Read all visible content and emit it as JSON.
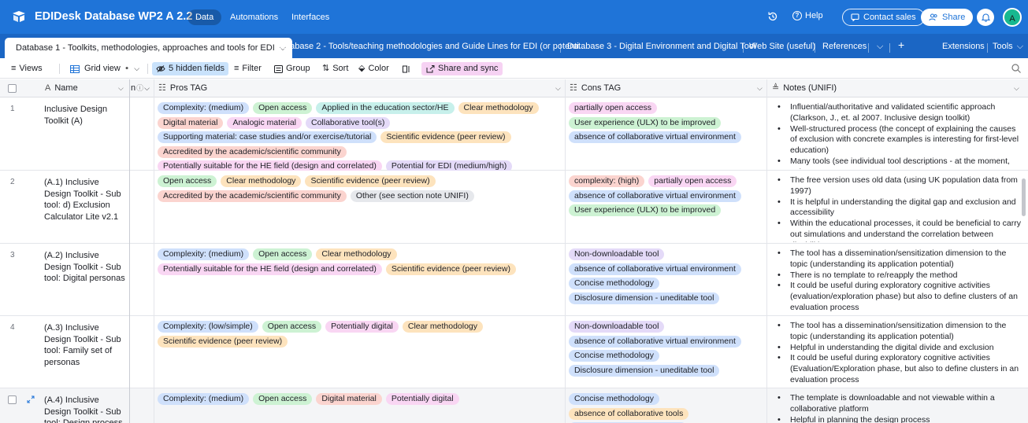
{
  "app": {
    "base_title": "EDIDesk Database WP2 A 2.2",
    "nav": [
      "Data",
      "Automations",
      "Interfaces"
    ],
    "help": "Help",
    "contact_sales": "Contact sales",
    "share": "Share",
    "avatar": "A",
    "accent": "#1f74d8"
  },
  "tables": {
    "active": "Database 1 - Toolkits, methodologies, approaches and tools for EDI",
    "others": [
      "Database 2 - Tools/teaching methodologies and Guide Lines for EDI (or potenti...",
      "Database 3 - Digital Environment and Digital Tool",
      "Web Site (useful)",
      "References"
    ],
    "add": "+",
    "extensions": "Extensions",
    "tools": "Tools"
  },
  "viewbar": {
    "views": "Views",
    "grid_view": "Grid view",
    "hidden_fields": "5 hidden fields",
    "filter": "Filter",
    "group": "Group",
    "sort": "Sort",
    "color": "Color",
    "share_sync": "Share and sync"
  },
  "columns": {
    "name": "Name",
    "hidden_fragment": "n",
    "pros": "Pros TAG",
    "cons": "Cons TAG",
    "notes": "Notes (UNIFI)"
  },
  "rows": [
    {
      "num": "1",
      "name": "Inclusive Design Toolkit (A)",
      "pros": [
        {
          "t": "Complexity: (medium)",
          "c": "blue"
        },
        {
          "t": "Open access",
          "c": "green"
        },
        {
          "t": "Applied in the education sector/HE",
          "c": "teal"
        },
        {
          "t": "Clear methodology",
          "c": "orange"
        },
        {
          "t": "Digital material",
          "c": "red"
        },
        {
          "t": "Analogic material",
          "c": "pink"
        },
        {
          "t": "Collaborative tool(s)",
          "c": "purple"
        },
        {
          "t": "Supporting material: case studies and/or exercise/tutorial",
          "c": "blue"
        },
        {
          "t": "Scientific evidence (peer review)",
          "c": "orange"
        },
        {
          "t": "Accredited by the academic/scientific community",
          "c": "red"
        },
        {
          "t": "Potentially suitable for the HE field (design and correlated)",
          "c": "pink"
        },
        {
          "t": "Potential for EDI (medium/high)",
          "c": "purple"
        }
      ],
      "cons": [
        {
          "t": "partially open access",
          "c": "pink"
        },
        {
          "t": "User experience (ULX) to be improved",
          "c": "green"
        },
        {
          "t": "absence of collaborative virtual environment",
          "c": "blue"
        }
      ],
      "notes": [
        "Influential/authoritative and validated scientific approach (Clarkson, J., et. al 2007. Inclusive design toolkit)",
        "Well-structured process (the concept of explaining the causes of exclusion with concrete examples is interesting for first-level education)",
        "Many tools (see individual tool descriptions - at the moment, only..."
      ]
    },
    {
      "num": "2",
      "name": "(A.1) Inclusive Design Toolkit  - Sub tool: d) Exclusion Calculator Lite v2.1",
      "pros": [
        {
          "t": "Open access",
          "c": "green"
        },
        {
          "t": "Clear methodology",
          "c": "orange"
        },
        {
          "t": "Scientific evidence (peer review)",
          "c": "orange"
        },
        {
          "t": "Accredited by the academic/scientific community",
          "c": "red"
        },
        {
          "t": "Other (see section note UNIFI)",
          "c": "gray"
        }
      ],
      "cons": [
        {
          "t": "complexity: (high)",
          "c": "red"
        },
        {
          "t": "partially open access",
          "c": "pink"
        },
        {
          "t": "absence of collaborative virtual environment",
          "c": "blue"
        },
        {
          "t": "User experience (ULX) to be improved",
          "c": "green"
        }
      ],
      "notes": [
        "The free version uses old data (using UK population data from 1997)",
        "It is helpful in understanding the digital gap and exclusion and accessibility",
        "Within the educational processes, it could be beneficial to carry out simulations and understand the correlation between disabiliti..."
      ]
    },
    {
      "num": "3",
      "name": "(A.2) Inclusive Design Toolkit  - Sub tool: Digital personas",
      "pros": [
        {
          "t": "Complexity: (medium)",
          "c": "blue"
        },
        {
          "t": "Open access",
          "c": "green"
        },
        {
          "t": "Clear methodology",
          "c": "orange"
        },
        {
          "t": "Potentially suitable for the HE field (design and correlated)",
          "c": "pink"
        },
        {
          "t": "Scientific evidence (peer review)",
          "c": "orange"
        }
      ],
      "cons": [
        {
          "t": "Non-downloadable tool",
          "c": "purple"
        },
        {
          "t": "absence of collaborative virtual environment",
          "c": "blue"
        },
        {
          "t": "Concise methodology",
          "c": "blue"
        },
        {
          "t": "Disclosure dimension - uneditable tool",
          "c": "blue"
        }
      ],
      "notes": [
        "The tool has a dissemination/sensitization dimension to the topic (understanding its application potential)",
        "There is no template to re/reapply the method",
        "It could be useful during exploratory cognitive activities (evaluation/exploration phase) but also to define clusters of an evaluation process"
      ]
    },
    {
      "num": "4",
      "name": "(A.3) Inclusive Design Toolkit  - Sub tool: Family set of personas",
      "pros": [
        {
          "t": "Complexity: (low/simple)",
          "c": "blue"
        },
        {
          "t": "Open access",
          "c": "green"
        },
        {
          "t": "Potentially digital",
          "c": "pink"
        },
        {
          "t": "Clear methodology",
          "c": "orange"
        },
        {
          "t": "Scientific evidence (peer review)",
          "c": "orange"
        }
      ],
      "cons": [
        {
          "t": "Non-downloadable tool",
          "c": "purple"
        },
        {
          "t": "absence of collaborative virtual environment",
          "c": "blue"
        },
        {
          "t": "Concise methodology",
          "c": "blue"
        },
        {
          "t": "Disclosure dimension - uneditable tool",
          "c": "blue"
        }
      ],
      "notes": [
        "The tool has a dissemination/sensitization dimension to the topic (understanding its application potential)",
        "Helpful in understanding the digital divide and exclusion",
        "It could be useful during exploratory cognitive activities (Evaluation/Exploration phase, but also to define clusters in an evaluation process"
      ]
    },
    {
      "num": "",
      "name": "(A.4) Inclusive Design Toolkit  - Sub tool: Design process",
      "pros": [
        {
          "t": "Complexity: (medium)",
          "c": "blue"
        },
        {
          "t": "Open access",
          "c": "green"
        },
        {
          "t": "Digital material",
          "c": "red"
        },
        {
          "t": "Potentially digital",
          "c": "pink"
        }
      ],
      "cons": [
        {
          "t": "Concise methodology",
          "c": "blue"
        },
        {
          "t": "absence of collaborative tools",
          "c": "orange"
        },
        {
          "t": "",
          "c": "blue"
        }
      ],
      "notes": [
        "The template is downloadable and not viewable within a collaborative platform",
        "Helpful in planning the design process"
      ]
    }
  ]
}
